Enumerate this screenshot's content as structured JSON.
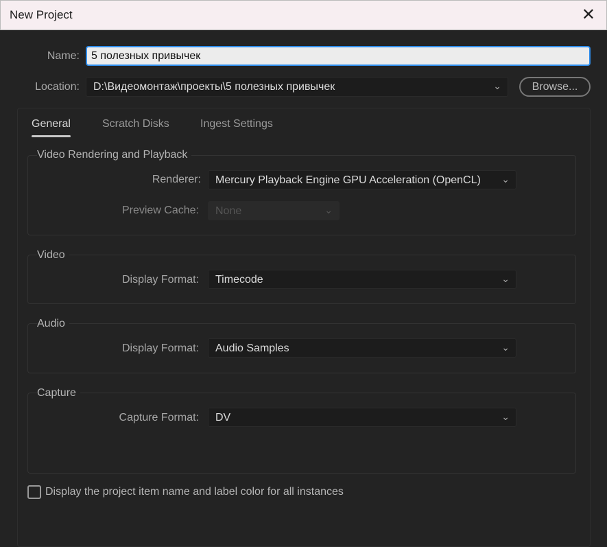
{
  "window": {
    "title": "New Project",
    "close": "✕"
  },
  "name": {
    "label": "Name:",
    "value": "5 полезных привычек"
  },
  "location": {
    "label": "Location:",
    "value": "D:\\Видеомонтаж\\проекты\\5 полезных привычек",
    "browse": "Browse..."
  },
  "tabs": [
    "General",
    "Scratch Disks",
    "Ingest Settings"
  ],
  "video_rendering": {
    "title": "Video Rendering and Playback",
    "renderer_label": "Renderer:",
    "renderer": "Mercury Playback Engine GPU Acceleration (OpenCL)",
    "cache_label": "Preview Cache:",
    "cache": "None"
  },
  "video": {
    "title": "Video",
    "label": "Display Format:",
    "value": "Timecode"
  },
  "audio": {
    "title": "Audio",
    "label": "Display Format:",
    "value": "Audio Samples"
  },
  "capture": {
    "title": "Capture",
    "label": "Capture Format:",
    "value": "DV"
  },
  "checkbox": {
    "label": "Display the project item name and label color for all instances",
    "checked": false
  },
  "chev": "⌄"
}
